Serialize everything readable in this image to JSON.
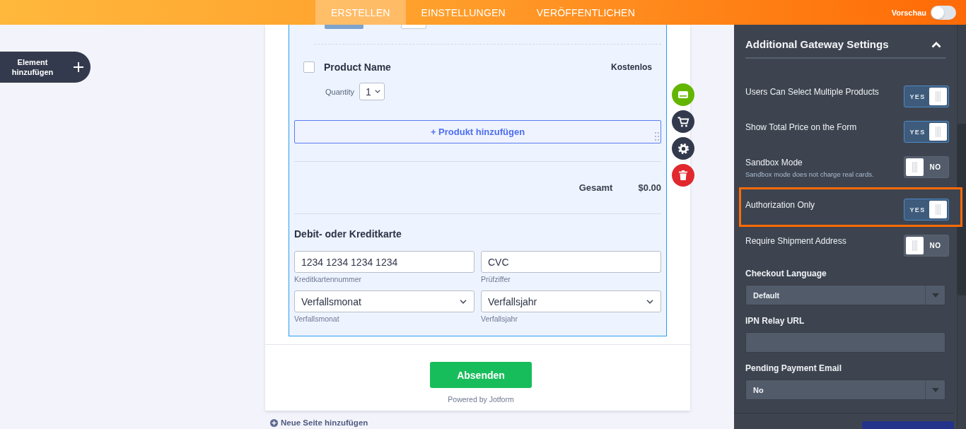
{
  "top_bar": {
    "tabs": [
      {
        "label": "ERSTELLEN",
        "selected": true
      },
      {
        "label": "EINSTELLUNGEN",
        "selected": false
      },
      {
        "label": "VERÖFFENTLICHEN",
        "selected": false
      }
    ],
    "preview": {
      "label": "Vorschau",
      "on": false
    }
  },
  "add_element_button": {
    "label": "Element hinzufügen"
  },
  "form": {
    "products": [
      {
        "name": "Product Name",
        "price": "Kostenlos",
        "checked": false,
        "quantity_label": "Quantity",
        "quantity": "1"
      }
    ],
    "add_product_button": "+ Produkt hinzufügen",
    "total": {
      "label": "Gesamt",
      "amount": "$0.00"
    },
    "card_section": {
      "title": "Debit- oder Kreditkarte",
      "fields": [
        {
          "kind": "input",
          "placeholder": "1234 1234 1234 1234",
          "sublabel": "Kreditkartennummer"
        },
        {
          "kind": "input",
          "placeholder": "CVC",
          "sublabel": "Prüfziffer"
        },
        {
          "kind": "select",
          "value": "Verfallsmonat",
          "sublabel": "Verfallsmonat"
        },
        {
          "kind": "select",
          "value": "Verfallsjahr",
          "sublabel": "Verfallsjahr"
        }
      ]
    },
    "submit_button": "Absenden",
    "powered_by": "Powered by Jotform"
  },
  "add_page_link": "Neue Seite hinzufügen",
  "settings_panel": {
    "title": "Additional Gateway Settings",
    "expanded": true,
    "settings": [
      {
        "kind": "toggle",
        "label": "Users Can Select Multiple Products",
        "on": true,
        "value_text": "YES",
        "highlighted": false
      },
      {
        "kind": "toggle",
        "label": "Show Total Price on the Form",
        "on": true,
        "value_text": "YES",
        "highlighted": false
      },
      {
        "kind": "toggle",
        "label": "Sandbox Mode",
        "description": "Sandbox mode does not charge real cards.",
        "on": false,
        "value_text": "NO",
        "highlighted": false
      },
      {
        "kind": "toggle",
        "label": "Authorization Only",
        "on": true,
        "value_text": "YES",
        "highlighted": true
      },
      {
        "kind": "toggle",
        "label": "Require Shipment Address",
        "on": false,
        "value_text": "NO",
        "highlighted": false
      },
      {
        "kind": "select",
        "label": "Checkout Language",
        "value": "Default"
      },
      {
        "kind": "input",
        "label": "IPN Relay URL"
      },
      {
        "kind": "select",
        "label": "Pending Payment Email",
        "value": "No"
      }
    ]
  }
}
